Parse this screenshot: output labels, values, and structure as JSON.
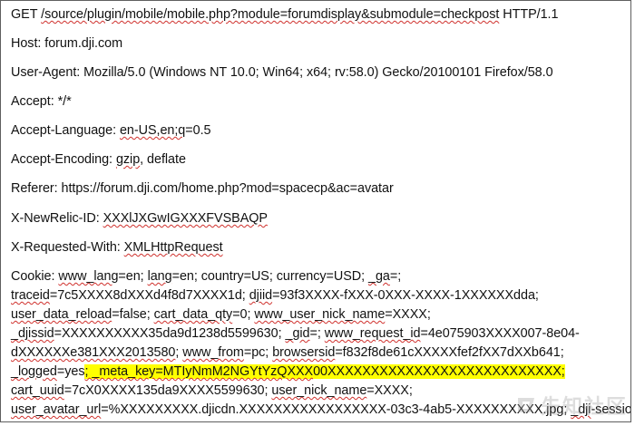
{
  "request": {
    "line1": {
      "method": "GET ",
      "path": "/source/plugin/mobile/mobile.php?module=forumdisplay&submodule=checkpost",
      "protocol": " HTTP/1.1"
    },
    "host": "Host: forum.dji.com",
    "user_agent": "User-Agent: Mozilla/5.0 (Windows NT 10.0; Win64; x64; rv:58.0) Gecko/20100101 Firefox/58.0",
    "accept": "Accept: */*",
    "accept_language": {
      "label": "Accept-Language: ",
      "value": "en-US,en;q",
      "rest": "=0.5"
    },
    "accept_encoding": {
      "label": "Accept-Encoding: ",
      "value": "gzip",
      "rest": ", deflate"
    },
    "referer": "Referer: https://forum.dji.com/home.php?mod=spacecp&ac=avatar",
    "newrelic": {
      "label": "X-NewRelic-ID: ",
      "value": "XXXlJXGwIGXXXFVSBAQP"
    },
    "requested_with": {
      "label": "X-Requested-With: ",
      "value": "XMLHttpRequest"
    },
    "cookie": {
      "l1a": "Cookie: ",
      "l1b": "www_lang",
      "l1c": "=en; ",
      "l1d": "lang",
      "l1e": "=en; country=US; currency=USD; ",
      "l1f": "_ga",
      "l1g": "=;",
      "l2a": "traceid",
      "l2b": "=7c5XXXX8dXXXd4f8d7XXXX1d; ",
      "l2c": "djiid",
      "l2d": "=93f3XXXX-fXXX-0XXX-XXXX-1XXXXXXdda;",
      "l3a": "user_data_reload",
      "l3b": "=false; ",
      "l3c": "cart_data_qty",
      "l3d": "=0; ",
      "l3e": "www_user_nick_name",
      "l3f": "=XXXX;",
      "l4a": "_djissid",
      "l4b": "=XXXXXXXXXX35da9d1238d5599630; ",
      "l4c": "_gid",
      "l4d": "=; ",
      "l4e": "www_request_id",
      "l4f": "=4e075903XXXX007-8e04-",
      "l5a": "dXXXXXXe381XXX2013580",
      "l5b": "; ",
      "l5c": "www_from",
      "l5d": "=pc; ",
      "l5e": "browsersid",
      "l5f": "=f832f8de61cXXXXXfef2fXX7dXXb641;",
      "l6a": "_logged",
      "l6b": "=yes",
      "l6c": "; _meta_key=MTIyNmM2NGYtYzQXXX",
      "l6d": "00XXXXXXXXXXXXXXXXXXXXXXXXXXX;",
      "l7a": "cart_uuid",
      "l7b": "=7cX0XXXX135da9XXXX5599630; ",
      "l7c": "user_nick_name",
      "l7d": "=XXXX;",
      "l8a": "user_avatar_url",
      "l8b": "=%XXXXXXXXX.djicdn.XXXXXXXXXXXXXXXXX-03c3-4ab5-XXXXXXXXXX.jpg; ",
      "l8c": "_dji",
      "l8d": "-session="
    }
  },
  "watermark": {
    "text": "先知社区",
    "color": "#9a9a9a"
  }
}
